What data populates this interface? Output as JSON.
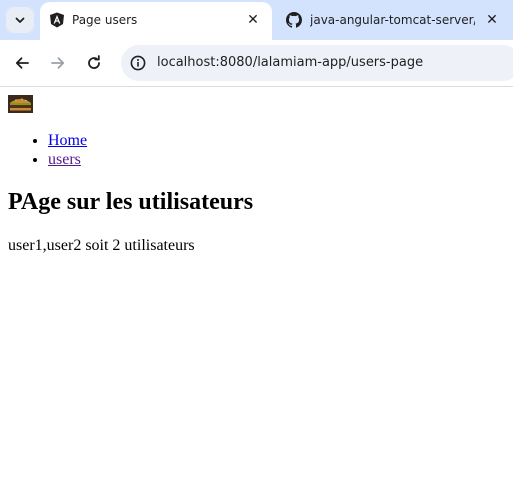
{
  "browser": {
    "tabs": [
      {
        "title": "Page users",
        "favicon": "angular-icon",
        "active": true
      },
      {
        "title": "java-angular-tomcat-server/RE",
        "favicon": "github-icon",
        "active": false
      }
    ],
    "close_glyph": "✕",
    "address": "localhost:8080/lalamiam-app/users-page"
  },
  "page": {
    "logo": "burger-logo",
    "nav": [
      {
        "label": "Home"
      },
      {
        "label": "users"
      }
    ],
    "heading": "PAge sur les utilisateurs",
    "summary": "user1,user2 soit 2 utilisateurs"
  }
}
